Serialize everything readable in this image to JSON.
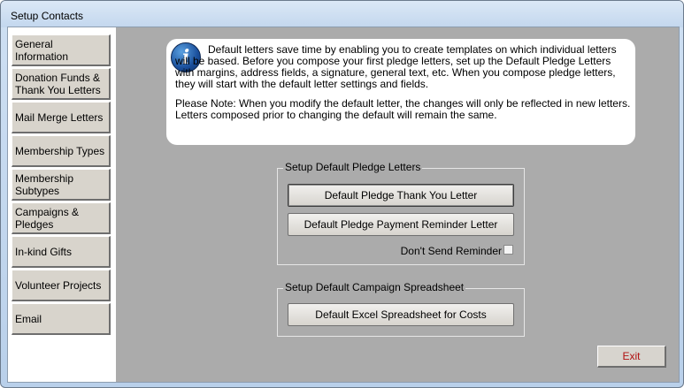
{
  "window": {
    "title": "Setup Contacts"
  },
  "sidebar": {
    "items": [
      {
        "label": "General Information"
      },
      {
        "label": "Donation Funds & Thank You Letters"
      },
      {
        "label": "Mail Merge Letters"
      },
      {
        "label": "Membership Types"
      },
      {
        "label": "Membership Subtypes"
      },
      {
        "label": "Campaigns & Pledges"
      },
      {
        "label": "In-kind Gifts"
      },
      {
        "label": "Volunteer Projects"
      },
      {
        "label": "Email"
      }
    ]
  },
  "info": {
    "icon": "info-icon",
    "paragraph1": "Default letters save time by enabling you to create templates on which individual letters will be based. Before you compose your first pledge letters, set up the Default Pledge Letters with margins, address fields, a signature, general text, etc. When you compose pledge letters, they will start with the default letter settings and fields.",
    "paragraph2": "Please Note:  When you modify the default letter, the changes will only be reflected in new letters. Letters composed prior to changing the default will remain the same."
  },
  "pledge_group": {
    "legend": "Setup Default Pledge Letters",
    "thank_you_button": "Default Pledge Thank You Letter",
    "reminder_button": "Default Pledge Payment Reminder Letter",
    "dont_send_reminder_label": "Don't Send Reminder",
    "dont_send_reminder_checked": false
  },
  "campaign_group": {
    "legend": "Setup Default Campaign Spreadsheet",
    "excel_button": "Default Excel Spreadsheet for Costs"
  },
  "footer": {
    "exit_label": "Exit",
    "exit_color": "#b01010"
  }
}
